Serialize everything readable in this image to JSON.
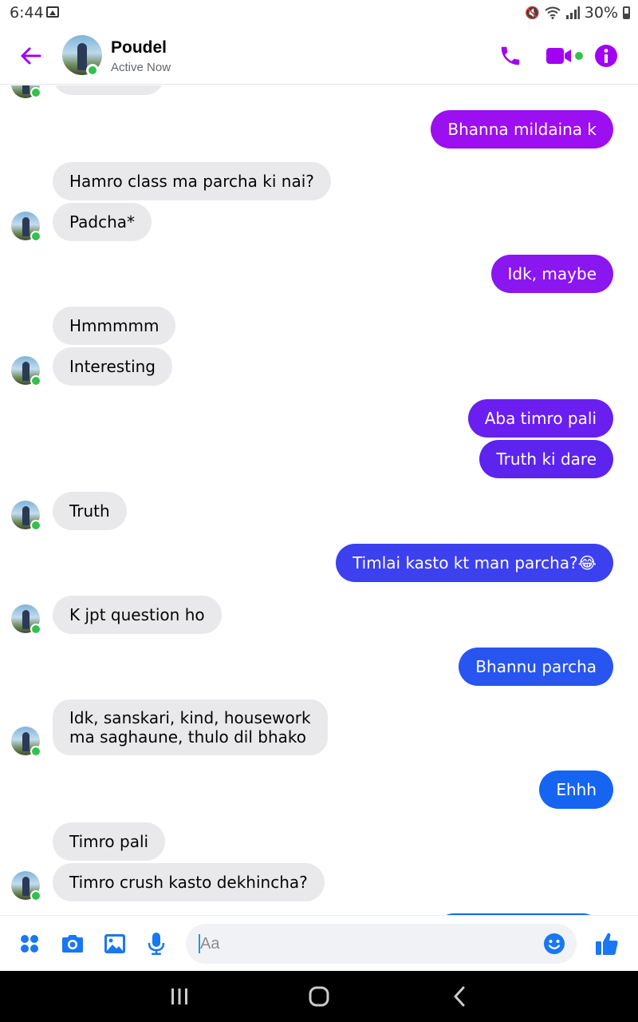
{
  "status_bar": {
    "time": "6:44",
    "battery": "30%"
  },
  "header": {
    "name": "Poudel",
    "status": "Active Now"
  },
  "colors": {
    "accent": "#a100f2",
    "online": "#31c24d",
    "incoming_bubble": "#e9e9eb"
  },
  "messages": [
    {
      "dir": "out",
      "text": "Bhanna mildaina k",
      "color": "#9b0ff0"
    },
    {
      "dir": "in",
      "text": "Hamro class ma parcha ki nai?"
    },
    {
      "dir": "in",
      "text": "Padcha*"
    },
    {
      "dir": "out",
      "text": "Idk, maybe",
      "color": "#8a16f0"
    },
    {
      "dir": "in",
      "text": "Hmmmmm"
    },
    {
      "dir": "in",
      "text": "Interesting"
    },
    {
      "dir": "out",
      "text": "Aba timro pali",
      "color": "#6a1ff0"
    },
    {
      "dir": "out",
      "text": "Truth ki dare",
      "color": "#5d24ef"
    },
    {
      "dir": "in",
      "text": "Truth"
    },
    {
      "dir": "out",
      "text": "Timlai kasto kt man parcha?😂",
      "color": "#3d40ef"
    },
    {
      "dir": "in",
      "text": "K jpt question ho"
    },
    {
      "dir": "out",
      "text": "Bhannu parcha",
      "color": "#2855f0"
    },
    {
      "dir": "in",
      "text": "Idk, sanskari, kind, housework ma saghaune, thulo dil bhako"
    },
    {
      "dir": "out",
      "text": "Ehhh",
      "color": "#1565f2"
    },
    {
      "dir": "in",
      "text": "Timro pali"
    },
    {
      "dir": "in",
      "text": "Timro crush kasto dekhincha?"
    }
  ],
  "composer": {
    "placeholder": "Aa"
  },
  "icons": {
    "back": "arrow-left-icon",
    "call": "phone-icon",
    "video": "video-camera-icon",
    "info": "info-icon",
    "more": "four-dots-icon",
    "camera": "camera-icon",
    "gallery": "image-icon",
    "mic": "microphone-icon",
    "emoji": "smiley-icon",
    "like": "thumbs-up-icon"
  }
}
